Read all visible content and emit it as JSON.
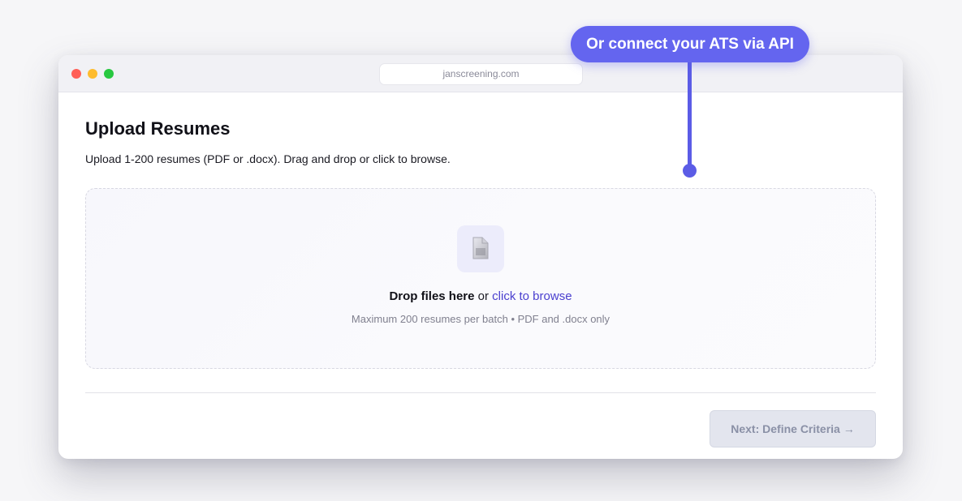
{
  "browser": {
    "url": "janscreening.com"
  },
  "page": {
    "title": "Upload Resumes",
    "subtitle": "Upload 1-200 resumes (PDF or .docx). Drag and drop or click to browse."
  },
  "dropzone": {
    "icon": "file-icon",
    "drop_label": "Drop files here",
    "or_text": " or ",
    "browse_label": "click to browse",
    "hint": "Maximum 200 resumes per batch • PDF and .docx only"
  },
  "footer": {
    "next_label": "Next: Define Criteria →"
  },
  "callout": {
    "label": "Or connect your ATS via API"
  },
  "colors": {
    "accent": "#6465ef",
    "link": "#4a3fcf",
    "button_disabled_bg": "#e3e5ee",
    "button_disabled_text": "#8a90a6"
  }
}
